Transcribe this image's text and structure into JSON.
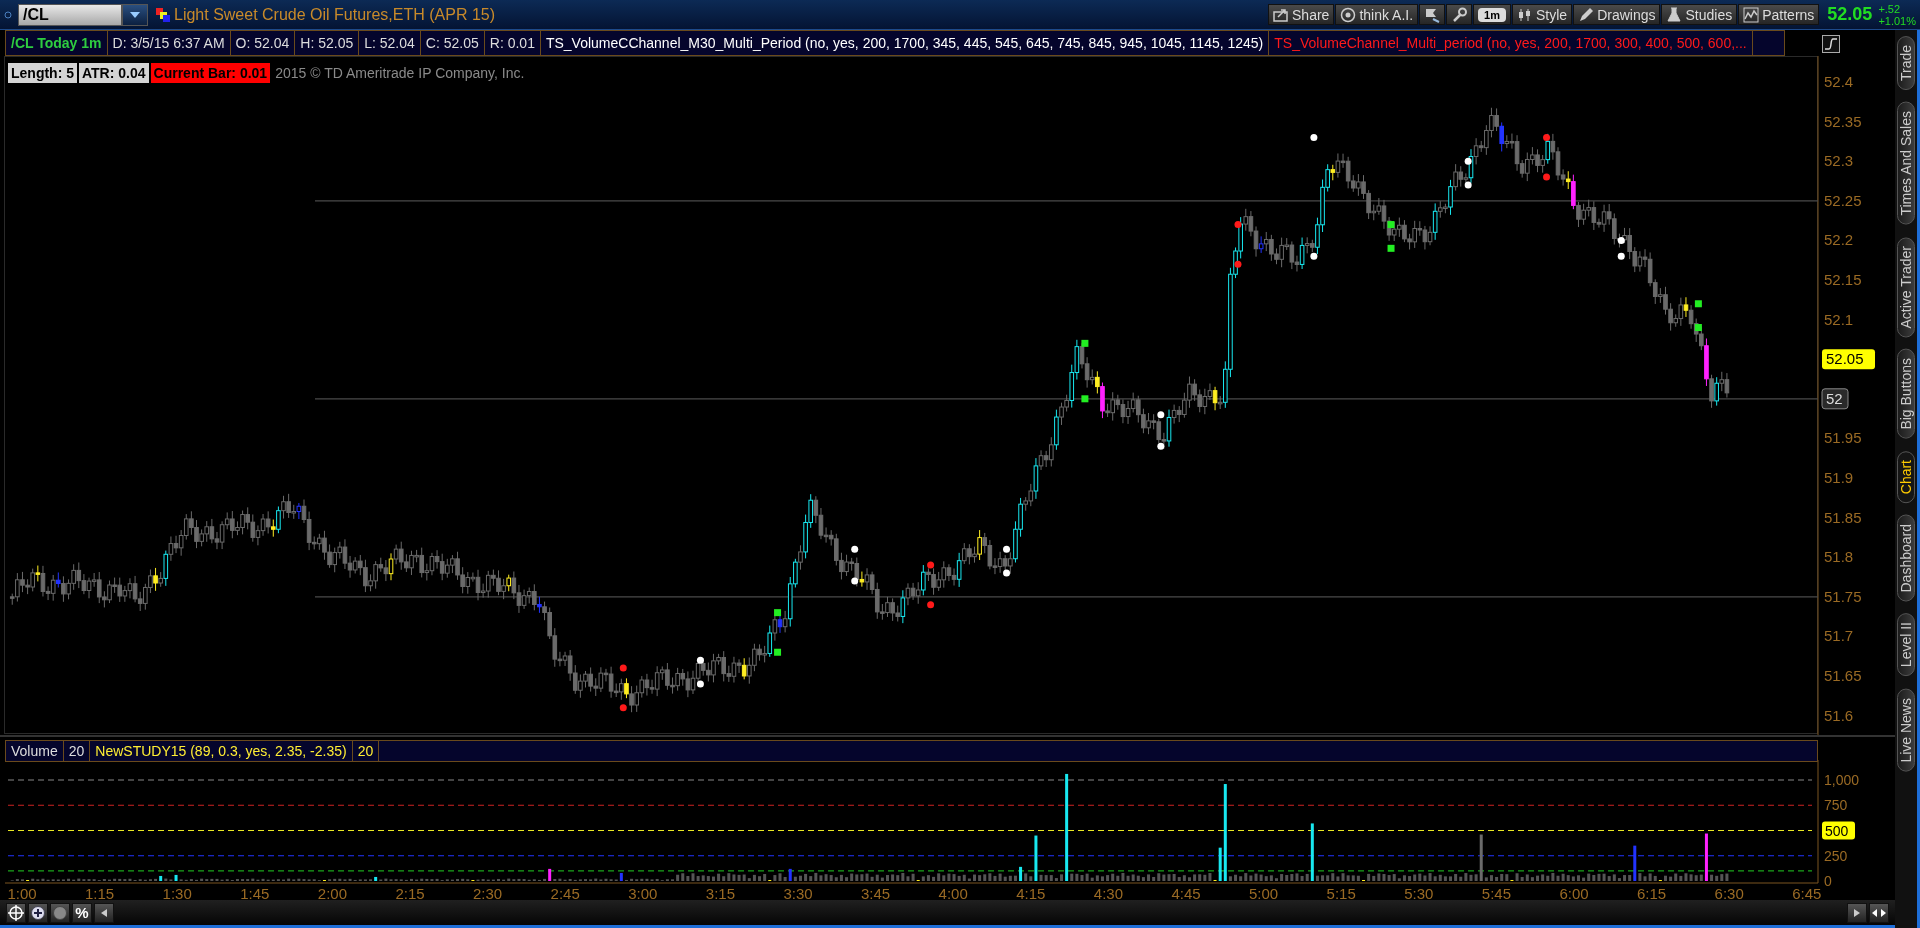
{
  "symbol_field": {
    "value": "/CL"
  },
  "instrument_title": "Light Sweet Crude Oil Futures,ETH (APR 15)",
  "toolbar": [
    {
      "kind": "labeled",
      "label": "Share"
    },
    {
      "kind": "labeled",
      "label": "think A.I."
    },
    {
      "kind": "icon"
    },
    {
      "kind": "icon"
    },
    {
      "kind": "pill",
      "label": "1m"
    },
    {
      "kind": "labeled",
      "label": "Style"
    },
    {
      "kind": "labeled",
      "label": "Drawings"
    },
    {
      "kind": "labeled",
      "label": "Studies"
    },
    {
      "kind": "labeled",
      "label": "Patterns"
    }
  ],
  "quote": {
    "last": "52.05",
    "change": "+.52",
    "change_pct": "+1.01%"
  },
  "study_header": {
    "chart_label": "/CL Today 1m",
    "fields": [
      "D: 3/5/15 6:37 AM",
      "O: 52.04",
      "H: 52.05",
      "L: 52.04",
      "C: 52.05",
      "R: 0.01"
    ],
    "studies": [
      {
        "label": "TS_VolumeCChannel_M30_Multi_Period (no, yes, 200, 1700, 345, 445, 545, 645, 745, 845, 945, 1045, 1145, 1245)",
        "kind": "normal"
      },
      {
        "label": "TS_VolumeChannel_Multi_period (no, yes, 200, 1700, 300, 400, 500, 600,...",
        "kind": "alert"
      }
    ]
  },
  "legend": [
    {
      "kind": "plain",
      "label": "Length: 5"
    },
    {
      "kind": "plain",
      "label": "ATR: 0.04"
    },
    {
      "kind": "alert",
      "label": "Current Bar: 0.01"
    }
  ],
  "copyright": "2015 © TD Ameritrade IP Company, Inc.",
  "price_axis": {
    "labels": [
      "52.4",
      "52.35",
      "52.3",
      "52.25",
      "52.2",
      "52.15",
      "52.1",
      "51.95",
      "51.9",
      "51.85",
      "51.8",
      "51.75",
      "51.7",
      "51.65",
      "51.6"
    ],
    "last_price": "52.05",
    "level_marker": "52"
  },
  "volume_pane": {
    "header": [
      {
        "label": "Volume",
        "kind": "volume"
      },
      {
        "label": "20",
        "kind": "volume"
      },
      {
        "label": "NewSTUDY15 (89, 0.3, yes, 2.35, -2.35)",
        "kind": "study"
      },
      {
        "label": "20",
        "kind": "study"
      }
    ],
    "axis_labels": [
      {
        "text": "1,000",
        "highlighted": false
      },
      {
        "text": "750",
        "highlighted": false
      },
      {
        "text": "500",
        "highlighted": true
      },
      {
        "text": "250",
        "highlighted": false
      },
      {
        "text": "0",
        "highlighted": false
      }
    ]
  },
  "time_axis": [
    "1:00",
    "1:15",
    "1:30",
    "1:45",
    "2:00",
    "2:15",
    "2:30",
    "2:45",
    "3:00",
    "3:15",
    "3:30",
    "3:45",
    "4:00",
    "4:15",
    "4:30",
    "4:45",
    "5:00",
    "5:15",
    "5:30",
    "5:45",
    "6:00",
    "6:15",
    "6:30",
    "6:45"
  ],
  "percent_button": "%",
  "side_tabs": [
    {
      "label": "Trade",
      "selected": false
    },
    {
      "label": "Times And Sales",
      "selected": false
    },
    {
      "label": "Active Trader",
      "selected": false
    },
    {
      "label": "Big Buttons",
      "selected": false
    },
    {
      "label": "Chart",
      "selected": true
    },
    {
      "label": "Dashboard",
      "selected": false
    },
    {
      "label": "Level II",
      "selected": false
    },
    {
      "label": "Live News",
      "selected": false
    }
  ]
}
